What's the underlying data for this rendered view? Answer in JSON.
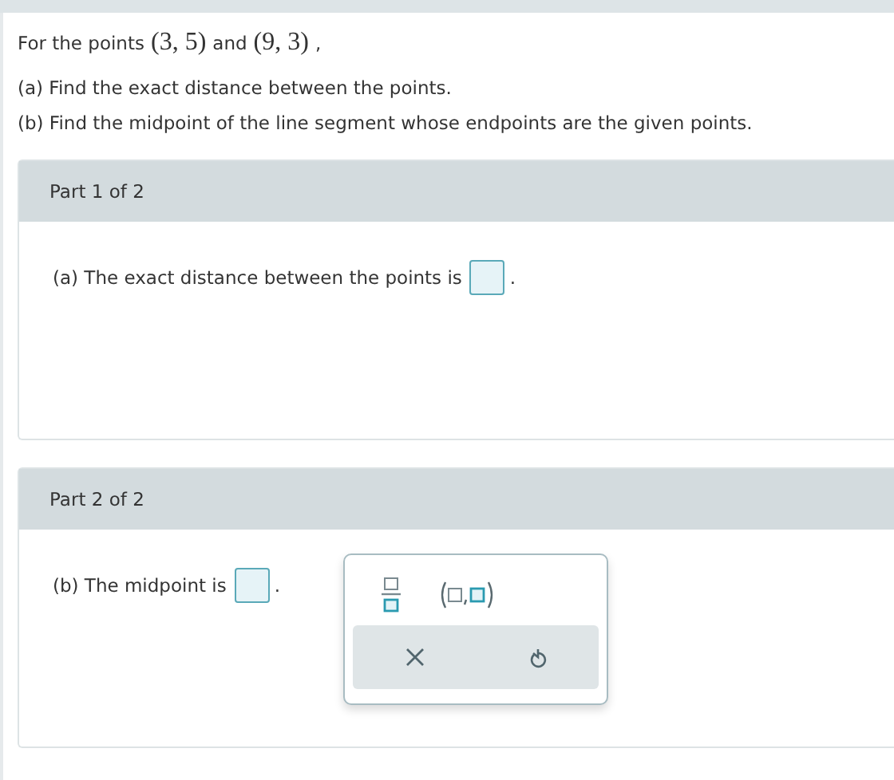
{
  "intro": {
    "lead": "For the points",
    "point_a": "(3, 5)",
    "joiner": "and",
    "point_b": "(9, 3)",
    "tail": ","
  },
  "questions": [
    "(a) Find the exact distance between the points.",
    "(b) Find the midpoint of the line segment whose endpoints are the given points."
  ],
  "parts": [
    {
      "header": "Part 1 of 2",
      "prompt": "(a) The exact distance between the points is",
      "after": ".",
      "palette": false
    },
    {
      "header": "Part 2 of 2",
      "prompt": "(b) The midpoint is",
      "after": ".",
      "palette": true
    }
  ]
}
